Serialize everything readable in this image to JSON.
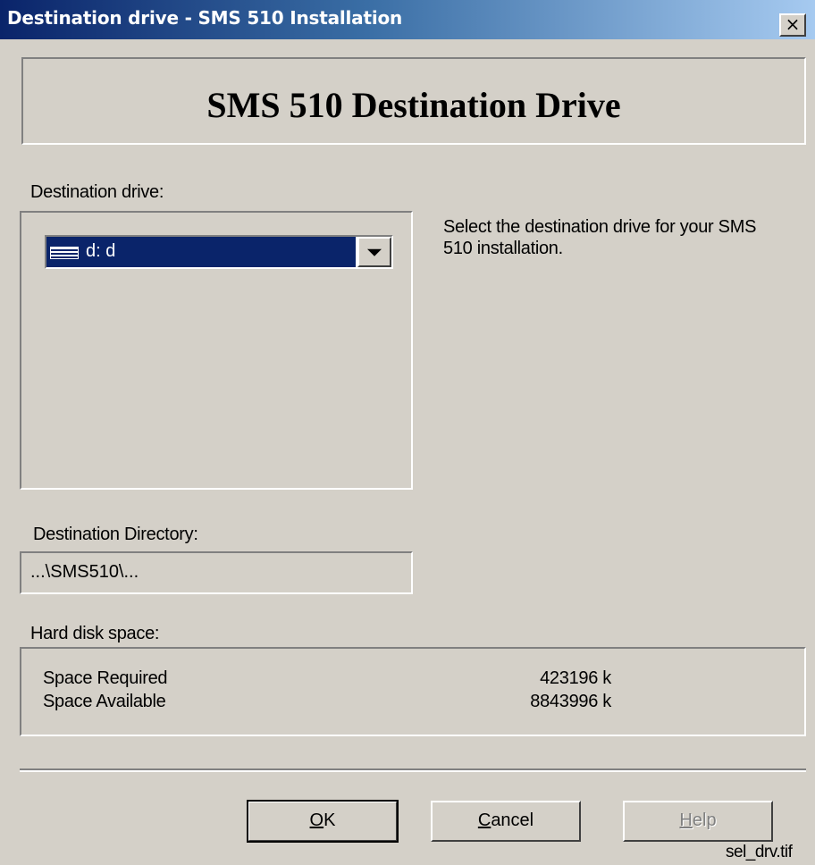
{
  "window": {
    "title": "Destination drive - SMS 510 Installation",
    "close_glyph": "×"
  },
  "banner": {
    "heading": "SMS 510 Destination Drive"
  },
  "drive": {
    "label": "Destination drive:",
    "selected": "d:  d",
    "icon": "drive-icon"
  },
  "instructions": {
    "text": "Select the destination drive for your SMS 510 installation."
  },
  "directory": {
    "label": "Destination Directory:",
    "value": "...\\SMS510\\..."
  },
  "disk_space": {
    "label": "Hard disk space:",
    "rows": [
      {
        "label": "Space Required",
        "value": "423196 k"
      },
      {
        "label": "Space Available",
        "value": "8843996 k"
      }
    ]
  },
  "buttons": {
    "ok": {
      "mnemonic": "O",
      "rest": "K"
    },
    "cancel": {
      "mnemonic": "C",
      "rest": "ancel"
    },
    "help": {
      "mnemonic": "H",
      "rest": "elp",
      "enabled": false
    }
  },
  "caption": "sel_drv.tif",
  "colors": {
    "face": "#d4d0c8",
    "title_start": "#0a246a",
    "title_end": "#a6caf0",
    "selection": "#0a246a",
    "disabled_text": "#808080"
  }
}
